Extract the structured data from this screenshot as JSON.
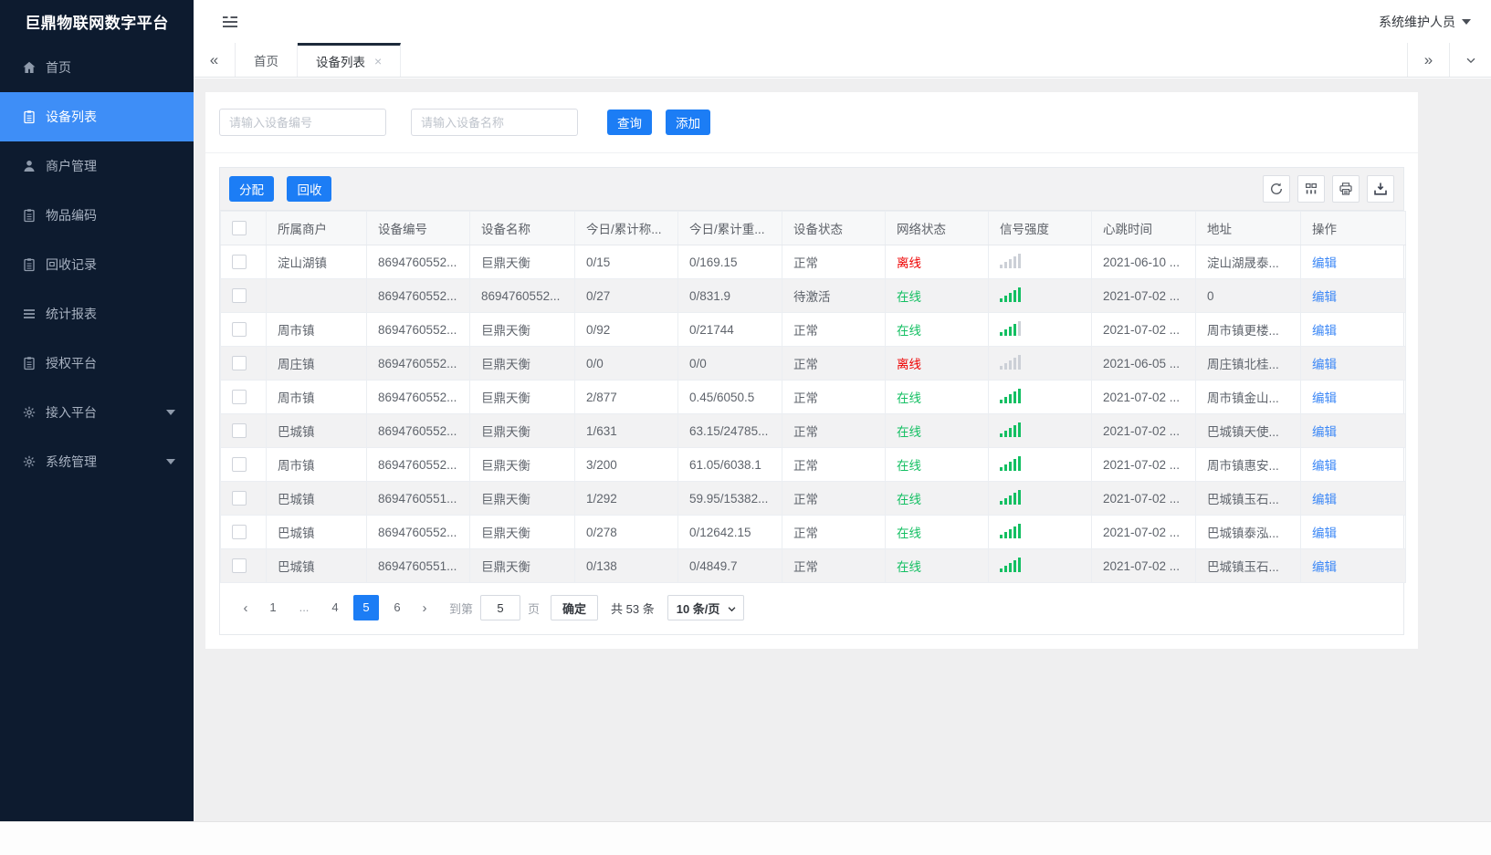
{
  "app": {
    "title": "巨鼎物联网数字平台",
    "user_menu": "系统维护人员"
  },
  "sidebar": {
    "items": [
      {
        "icon": "home-icon",
        "label": "首页"
      },
      {
        "icon": "device-list-icon",
        "label": "设备列表",
        "active": true
      },
      {
        "icon": "merchant-icon",
        "label": "商户管理"
      },
      {
        "icon": "item-code-icon",
        "label": "物品编码"
      },
      {
        "icon": "recycle-record-icon",
        "label": "回收记录"
      },
      {
        "icon": "report-icon",
        "label": "统计报表"
      },
      {
        "icon": "authorize-icon",
        "label": "授权平台"
      },
      {
        "icon": "access-platform-icon",
        "label": "接入平台",
        "expandable": true
      },
      {
        "icon": "system-manage-icon",
        "label": "系统管理",
        "expandable": true
      }
    ]
  },
  "tabbar": {
    "tabs": [
      {
        "label": "首页"
      },
      {
        "label": "设备列表",
        "active": true,
        "closable": true,
        "close_glyph": "×"
      }
    ]
  },
  "search": {
    "device_no_placeholder": "请输入设备编号",
    "device_name_placeholder": "请输入设备名称",
    "query_label": "查询",
    "add_label": "添加"
  },
  "toolbar": {
    "assign_label": "分配",
    "recycle_label": "回收",
    "icons": [
      "refresh-icon",
      "columns-icon",
      "print-icon",
      "export-icon"
    ]
  },
  "table": {
    "columns": [
      "所属商户",
      "设备编号",
      "设备名称",
      "今日/累计称...",
      "今日/累计重...",
      "设备状态",
      "网络状态",
      "信号强度",
      "心跳时间",
      "地址",
      "操作"
    ],
    "signal_bars_total": 5,
    "rows": [
      {
        "merchant": "淀山湖镇",
        "device_no": "8694760552...",
        "device_name": "巨鼎天衡",
        "today_count": "0/15",
        "today_weight": "0/169.15",
        "device_status": "正常",
        "network_status": "离线",
        "network_state": "offline",
        "signal_green": 0,
        "heartbeat": "2021-06-10 ...",
        "address": "淀山湖晟泰...",
        "action": "编辑"
      },
      {
        "merchant": "",
        "device_no": "8694760552...",
        "device_name": "8694760552...",
        "today_count": "0/27",
        "today_weight": "0/831.9",
        "device_status": "待激活",
        "network_status": "在线",
        "network_state": "online",
        "signal_green": 5,
        "heartbeat": "2021-07-02 ...",
        "address": "0",
        "action": "编辑"
      },
      {
        "merchant": "周市镇",
        "device_no": "8694760552...",
        "device_name": "巨鼎天衡",
        "today_count": "0/92",
        "today_weight": "0/21744",
        "device_status": "正常",
        "network_status": "在线",
        "network_state": "online",
        "signal_green": 4,
        "heartbeat": "2021-07-02 ...",
        "address": "周市镇更楼...",
        "action": "编辑"
      },
      {
        "merchant": "周庄镇",
        "device_no": "8694760552...",
        "device_name": "巨鼎天衡",
        "today_count": "0/0",
        "today_weight": "0/0",
        "device_status": "正常",
        "network_status": "离线",
        "network_state": "offline",
        "signal_green": 0,
        "heartbeat": "2021-06-05 ...",
        "address": "周庄镇北桂...",
        "action": "编辑"
      },
      {
        "merchant": "周市镇",
        "device_no": "8694760552...",
        "device_name": "巨鼎天衡",
        "today_count": "2/877",
        "today_weight": "0.45/6050.5",
        "device_status": "正常",
        "network_status": "在线",
        "network_state": "online",
        "signal_green": 5,
        "heartbeat": "2021-07-02 ...",
        "address": "周市镇金山...",
        "action": "编辑"
      },
      {
        "merchant": "巴城镇",
        "device_no": "8694760552...",
        "device_name": "巨鼎天衡",
        "today_count": "1/631",
        "today_weight": "63.15/24785...",
        "device_status": "正常",
        "network_status": "在线",
        "network_state": "online",
        "signal_green": 5,
        "heartbeat": "2021-07-02 ...",
        "address": "巴城镇天使...",
        "action": "编辑"
      },
      {
        "merchant": "周市镇",
        "device_no": "8694760552...",
        "device_name": "巨鼎天衡",
        "today_count": "3/200",
        "today_weight": "61.05/6038.1",
        "device_status": "正常",
        "network_status": "在线",
        "network_state": "online",
        "signal_green": 5,
        "heartbeat": "2021-07-02 ...",
        "address": "周市镇惠安...",
        "action": "编辑"
      },
      {
        "merchant": "巴城镇",
        "device_no": "8694760551...",
        "device_name": "巨鼎天衡",
        "today_count": "1/292",
        "today_weight": "59.95/15382...",
        "device_status": "正常",
        "network_status": "在线",
        "network_state": "online",
        "signal_green": 5,
        "heartbeat": "2021-07-02 ...",
        "address": "巴城镇玉石...",
        "action": "编辑"
      },
      {
        "merchant": "巴城镇",
        "device_no": "8694760552...",
        "device_name": "巨鼎天衡",
        "today_count": "0/278",
        "today_weight": "0/12642.15",
        "device_status": "正常",
        "network_status": "在线",
        "network_state": "online",
        "signal_green": 5,
        "heartbeat": "2021-07-02 ...",
        "address": "巴城镇泰泓...",
        "action": "编辑"
      },
      {
        "merchant": "巴城镇",
        "device_no": "8694760551...",
        "device_name": "巨鼎天衡",
        "today_count": "0/138",
        "today_weight": "0/4849.7",
        "device_status": "正常",
        "network_status": "在线",
        "network_state": "online",
        "signal_green": 5,
        "heartbeat": "2021-07-02 ...",
        "address": "巴城镇玉石...",
        "action": "编辑"
      }
    ]
  },
  "pagination": {
    "pages": [
      "1",
      "...",
      "4",
      "5",
      "6"
    ],
    "active_page": "5",
    "prev_glyph": "‹",
    "next_glyph": "›",
    "goto_label": "到第",
    "goto_value": "5",
    "page_unit": "页",
    "confirm_label": "确定",
    "total_text": "共 53 条",
    "page_size": "10 条/页"
  },
  "colors": {
    "accent_blue": "#1c7df5",
    "sidebar_active_blue": "#3e8ef7",
    "online_green": "#13bf62",
    "offline_red": "#ee0000",
    "link_blue": "#3b87f6",
    "sidebar_bg": "#0d1b2f"
  }
}
